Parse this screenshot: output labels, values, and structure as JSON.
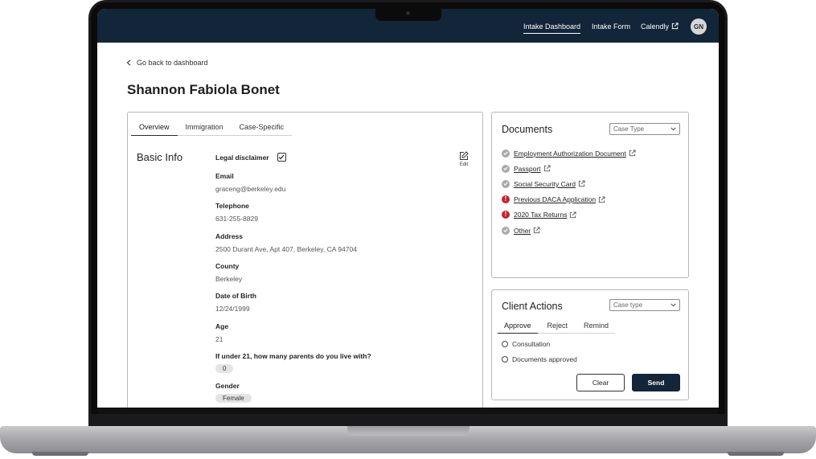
{
  "nav": {
    "links": [
      "Intake Dashboard",
      "Intake Form",
      "Calendly"
    ],
    "avatar_initials": "GN"
  },
  "back_link": "Go back to dashboard",
  "client_name": "Shannon Fabiola Bonet",
  "profile": {
    "tabs": [
      "Overview",
      "Immigration",
      "Case-Specific"
    ],
    "active_tab": "Overview",
    "section_title": "Basic Info",
    "edit_label": "Edit",
    "legal_disclaimer_label": "Legal disclaimer",
    "legal_disclaimer_checked": true,
    "fields": [
      {
        "label": "Email",
        "value": "graceng@berkeley.edu"
      },
      {
        "label": "Telephone",
        "value": "631-255-8829"
      },
      {
        "label": "Address",
        "value": "2500 Durant Ave, Apt 407, Berkeley, CA 94704"
      },
      {
        "label": "County",
        "value": "Berkeley"
      },
      {
        "label": "Date of Birth",
        "value": "12/24/1999"
      },
      {
        "label": "Age",
        "value": "21"
      },
      {
        "label": "If under 21, how many parents do you live with?",
        "value": "0"
      },
      {
        "label": "Gender",
        "value": "Female"
      }
    ]
  },
  "documents": {
    "title": "Documents",
    "select_value": "Case Type",
    "items": [
      {
        "label": "Employment Authorization Document",
        "status": "ok"
      },
      {
        "label": "Passport",
        "status": "ok"
      },
      {
        "label": "Social Security Card",
        "status": "ok"
      },
      {
        "label": "Previous DACA Application",
        "status": "error"
      },
      {
        "label": "2020 Tax Returns",
        "status": "error"
      },
      {
        "label": "Other",
        "status": "ok"
      }
    ]
  },
  "client_actions": {
    "title": "Client Actions",
    "select_value": "Case type",
    "tabs": [
      "Approve",
      "Reject",
      "Remind"
    ],
    "active_tab": "Approve",
    "options": [
      "Consultation",
      "Documents approved"
    ],
    "clear_label": "Clear",
    "send_label": "Send"
  },
  "colors": {
    "nav_bg": "#122539",
    "error": "#c8202c",
    "ok": "#a9a9a9"
  }
}
